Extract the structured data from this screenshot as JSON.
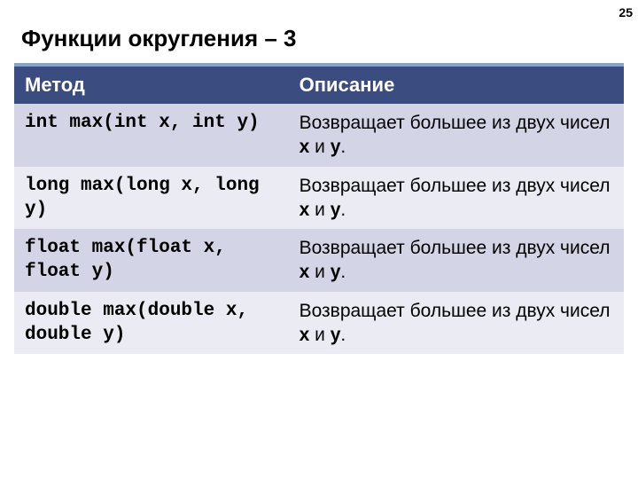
{
  "page_number": "25",
  "title": "Функции округления – 3",
  "headers": {
    "method": "Метод",
    "desc": "Описание"
  },
  "rows": [
    {
      "method": "int max(int x, int y)",
      "desc_pre": "Возвращает большее из двух чисел ",
      "x": "x",
      "and": " и ",
      "y": "y",
      "dot": "."
    },
    {
      "method": "long max(long x, long y)",
      "desc_pre": "Возвращает большее из двух чисел ",
      "x": "x",
      "and": " и ",
      "y": "y",
      "dot": "."
    },
    {
      "method": "float max(float x, float y)",
      "desc_pre": "Возвращает большее из двух чисел ",
      "x": "x",
      "and": " и ",
      "y": "y",
      "dot": "."
    },
    {
      "method": "double max(double x, double y)",
      "desc_pre": "Возвращает большее из двух чисел ",
      "x": "x",
      "and": " и ",
      "y": "y",
      "dot": "."
    }
  ]
}
